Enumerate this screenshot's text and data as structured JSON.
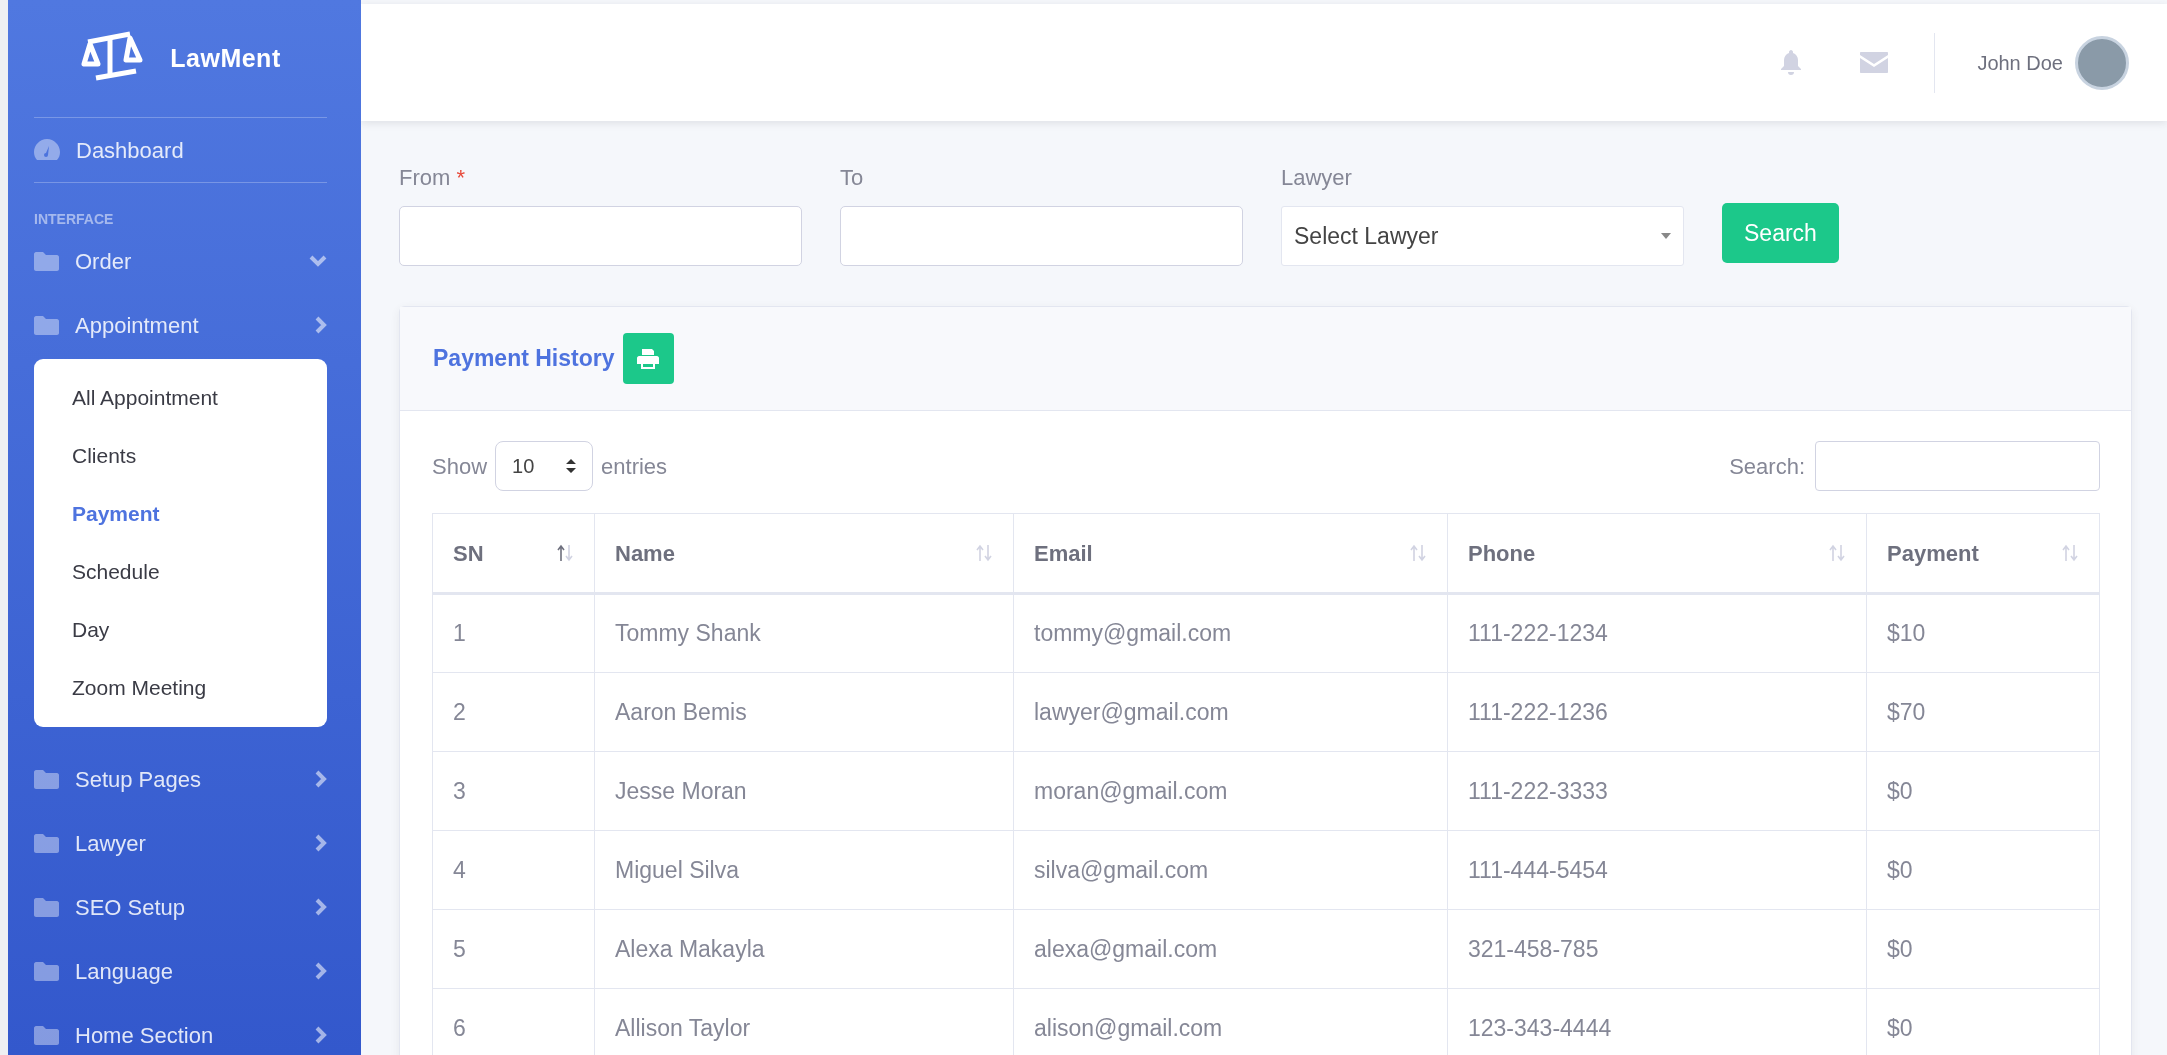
{
  "sidebar": {
    "brand": "LawMent",
    "items": [
      {
        "kind": "link",
        "label": "Dashboard",
        "selected": false
      },
      {
        "kind": "heading",
        "label": "INTERFACE"
      },
      {
        "kind": "folder",
        "label": "Order",
        "expanded": true
      },
      {
        "kind": "folder",
        "label": "Appointment",
        "expanded": false,
        "children": [
          {
            "label": "All Appointment",
            "selected": false
          },
          {
            "label": "Clients",
            "selected": false
          },
          {
            "label": "Payment",
            "selected": true
          },
          {
            "label": "Schedule",
            "selected": false
          },
          {
            "label": "Day",
            "selected": false
          },
          {
            "label": "Zoom Meeting",
            "selected": false
          }
        ]
      },
      {
        "kind": "folder",
        "label": "Setup Pages",
        "expanded": false
      },
      {
        "kind": "folder",
        "label": "Lawyer",
        "expanded": false
      },
      {
        "kind": "folder",
        "label": "SEO Setup",
        "expanded": false
      },
      {
        "kind": "folder",
        "label": "Language",
        "expanded": false
      },
      {
        "kind": "folder",
        "label": "Home Section",
        "expanded": false
      }
    ]
  },
  "topbar": {
    "user_name": "John Doe"
  },
  "filters": {
    "from_label": "From",
    "from_required_mark": "*",
    "to_label": "To",
    "lawyer_label": "Lawyer",
    "lawyer_value": "Select Lawyer",
    "search_button": "Search"
  },
  "card": {
    "title": "Payment History",
    "length": {
      "show": "Show",
      "value": "10",
      "entries": "entries"
    },
    "search_label": "Search:",
    "table": {
      "columns": [
        {
          "label": "SN",
          "sorted": true
        },
        {
          "label": "Name",
          "sorted": false
        },
        {
          "label": "Email",
          "sorted": false
        },
        {
          "label": "Phone",
          "sorted": false
        },
        {
          "label": "Payment",
          "sorted": false
        }
      ],
      "rows": [
        [
          "1",
          "Tommy Shank",
          "tommy@gmail.com",
          "111-222-1234",
          "$10"
        ],
        [
          "2",
          "Aaron Bemis",
          "lawyer@gmail.com",
          "111-222-1236",
          "$70"
        ],
        [
          "3",
          "Jesse Moran",
          "moran@gmail.com",
          "111-222-3333",
          "$0"
        ],
        [
          "4",
          "Miguel Silva",
          "silva@gmail.com",
          "111-444-5454",
          "$0"
        ],
        [
          "5",
          "Alexa Makayla",
          "alexa@gmail.com",
          "321-458-785",
          "$0"
        ],
        [
          "6",
          "Allison Taylor",
          "alison@gmail.com",
          "123-343-4444",
          "$0"
        ]
      ]
    }
  }
}
